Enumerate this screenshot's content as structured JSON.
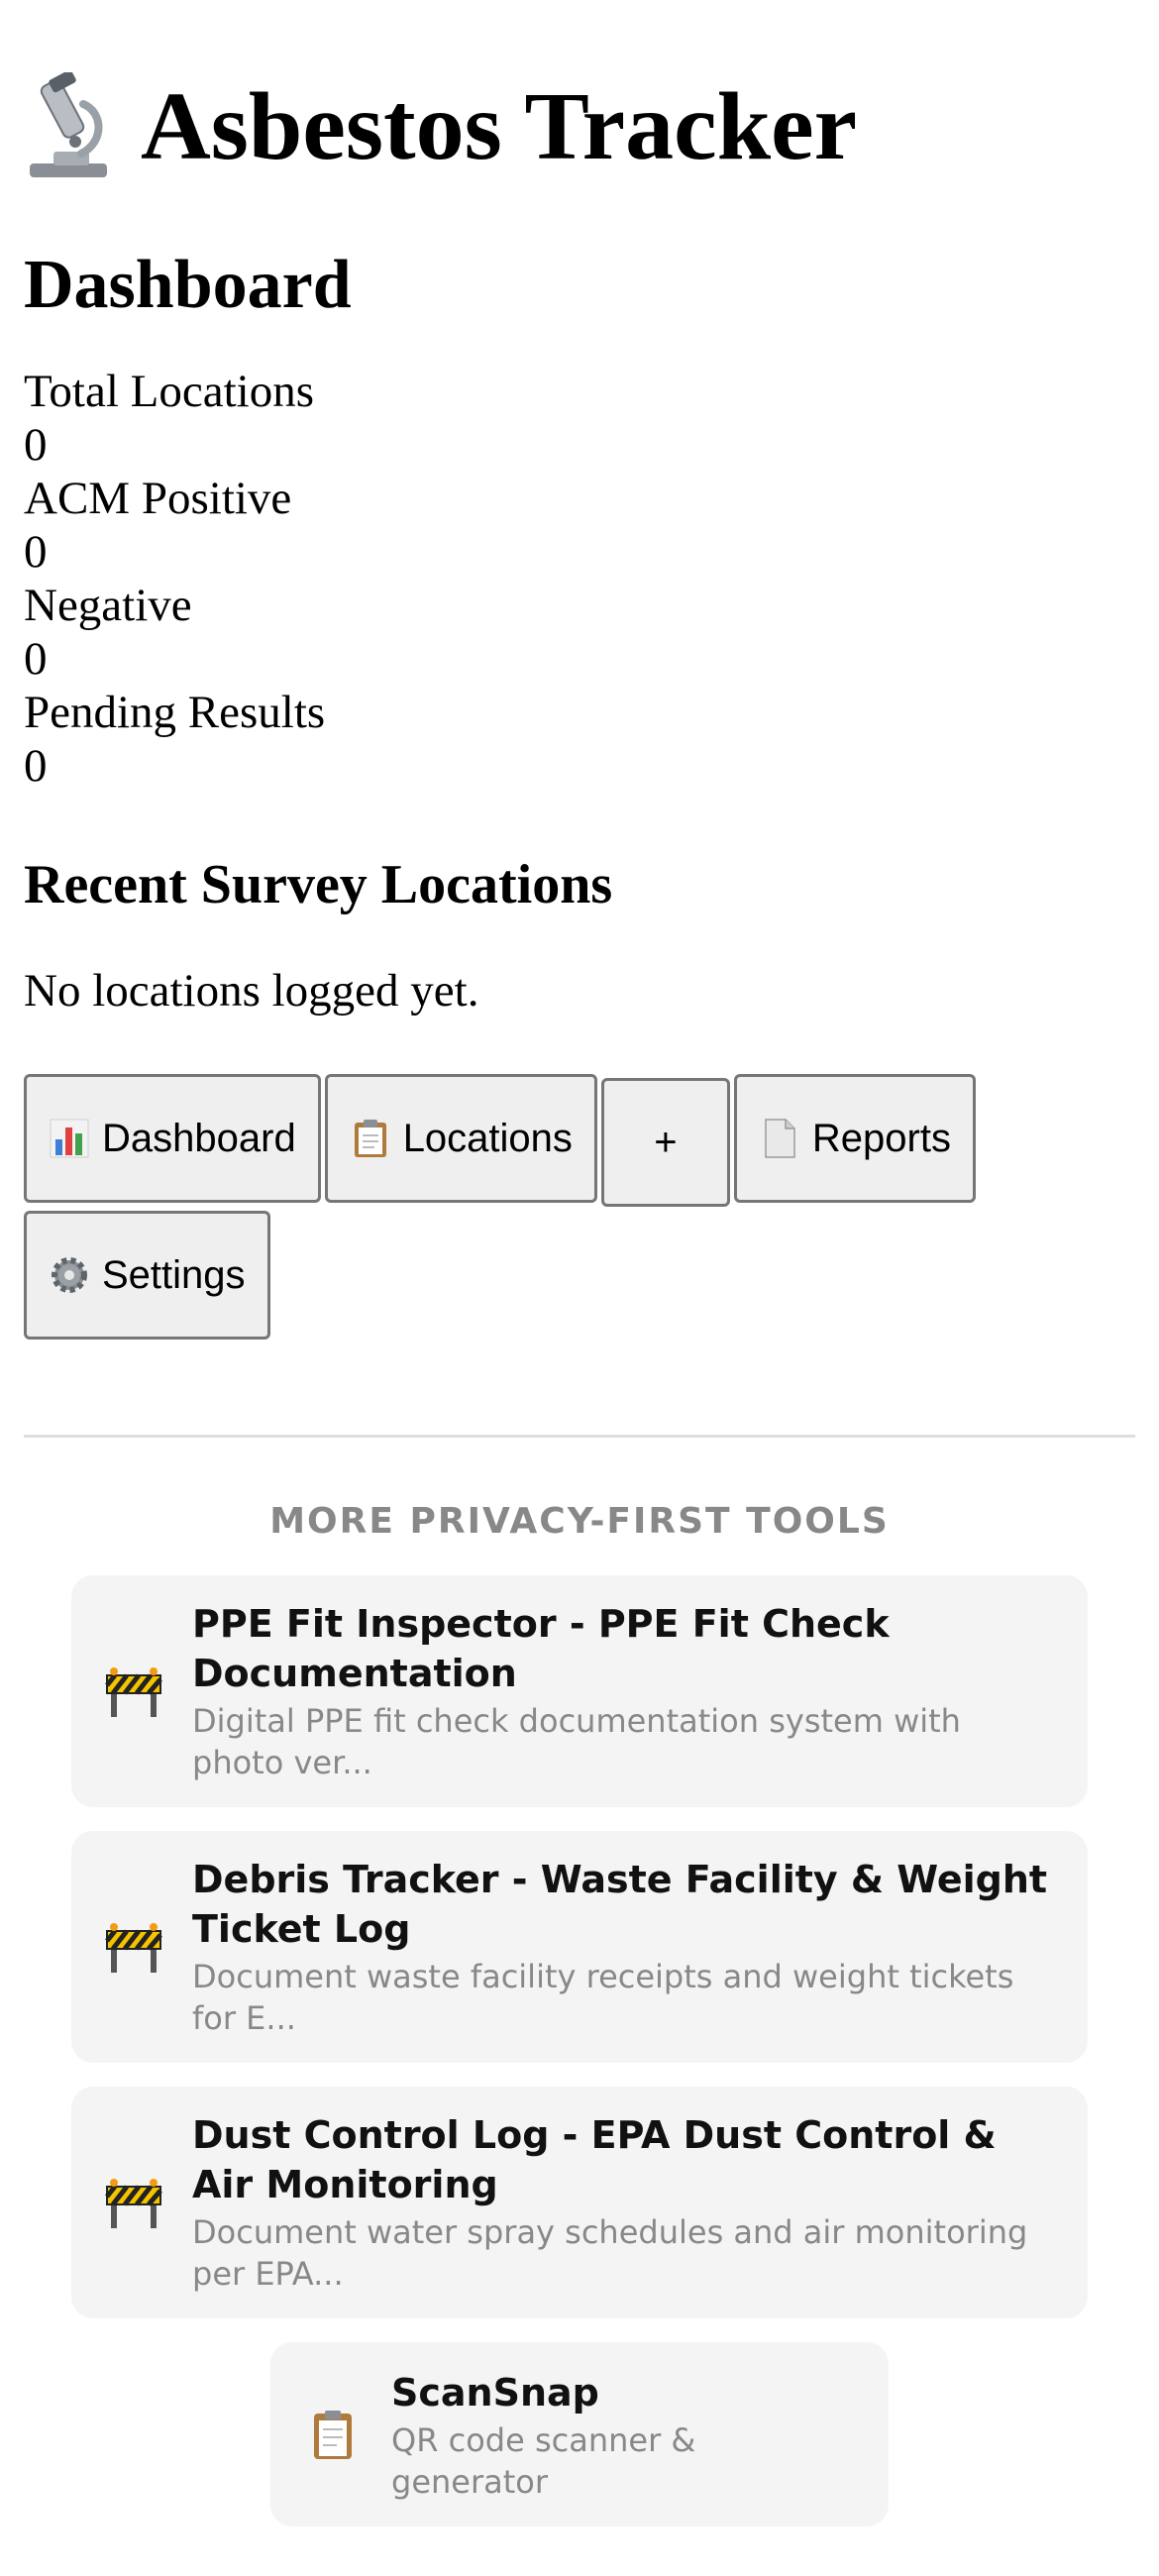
{
  "header": {
    "title": "Asbestos Tracker",
    "title_icon": "microscope-icon"
  },
  "dashboard": {
    "heading": "Dashboard",
    "stats": [
      {
        "label": "Total Locations",
        "value": "0"
      },
      {
        "label": "ACM Positive",
        "value": "0"
      },
      {
        "label": "Negative",
        "value": "0"
      },
      {
        "label": "Pending Results",
        "value": "0"
      }
    ]
  },
  "recent": {
    "heading": "Recent Survey Locations",
    "empty_text": "No locations logged yet."
  },
  "nav": {
    "dashboard": {
      "label": "Dashboard",
      "icon": "bar-chart-icon"
    },
    "locations": {
      "label": "Locations",
      "icon": "clipboard-icon"
    },
    "add": {
      "label": "+"
    },
    "reports": {
      "label": "Reports",
      "icon": "document-icon"
    },
    "settings": {
      "label": "Settings",
      "icon": "gear-icon"
    }
  },
  "more_tools": {
    "heading": "MORE PRIVACY-FIRST TOOLS",
    "items": [
      {
        "name": "PPE Fit Inspector - PPE Fit Check Documentation",
        "desc": "Digital PPE fit check documentation system with photo ver...",
        "icon": "construction-barrier-icon"
      },
      {
        "name": "Debris Tracker - Waste Facility & Weight Ticket Log",
        "desc": "Document waste facility receipts and weight tickets for E...",
        "icon": "construction-barrier-icon"
      },
      {
        "name": "Dust Control Log - EPA Dust Control & Air Monitoring",
        "desc": "Document water spray schedules and air monitoring per EPA...",
        "icon": "construction-barrier-icon"
      },
      {
        "name": "ScanSnap",
        "desc": "QR code scanner & generator",
        "icon": "clipboard-icon"
      }
    ]
  },
  "colors": {
    "button_bg": "#efefef",
    "button_border": "#767676",
    "card_bg": "#f4f4f4",
    "muted_text": "#888888"
  }
}
